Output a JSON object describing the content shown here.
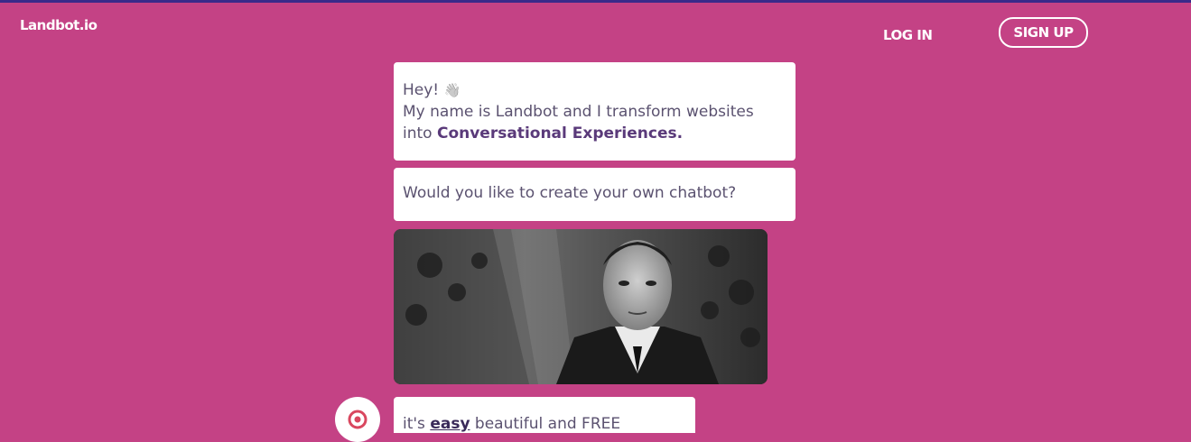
{
  "header": {
    "logo": "Landbot.io",
    "login_label": "LOG IN",
    "signup_label": "SIGN UP"
  },
  "chat": {
    "message1": {
      "line1": "Hey! ",
      "wave_emoji": "👋",
      "line2": "My name is Landbot and I transform websites",
      "line3_prefix": "into ",
      "line3_highlight": "Conversational Experiences."
    },
    "message2": {
      "text": "Would you like to create your own chatbot?"
    },
    "gif": {
      "icon": "man-in-suit-gif"
    },
    "message4": {
      "prefix": "it's ",
      "highlight": "easy",
      "suffix": " beautiful and FREE"
    },
    "avatar": {
      "icon": "landbot-logo-icon"
    }
  },
  "colors": {
    "background": "#c44285",
    "top_border": "#3a2a8a",
    "bubble": "#ffffff",
    "text": "#5b5270",
    "highlight_text": "#5a3a7a",
    "avatar_icon": "#d9475f"
  }
}
